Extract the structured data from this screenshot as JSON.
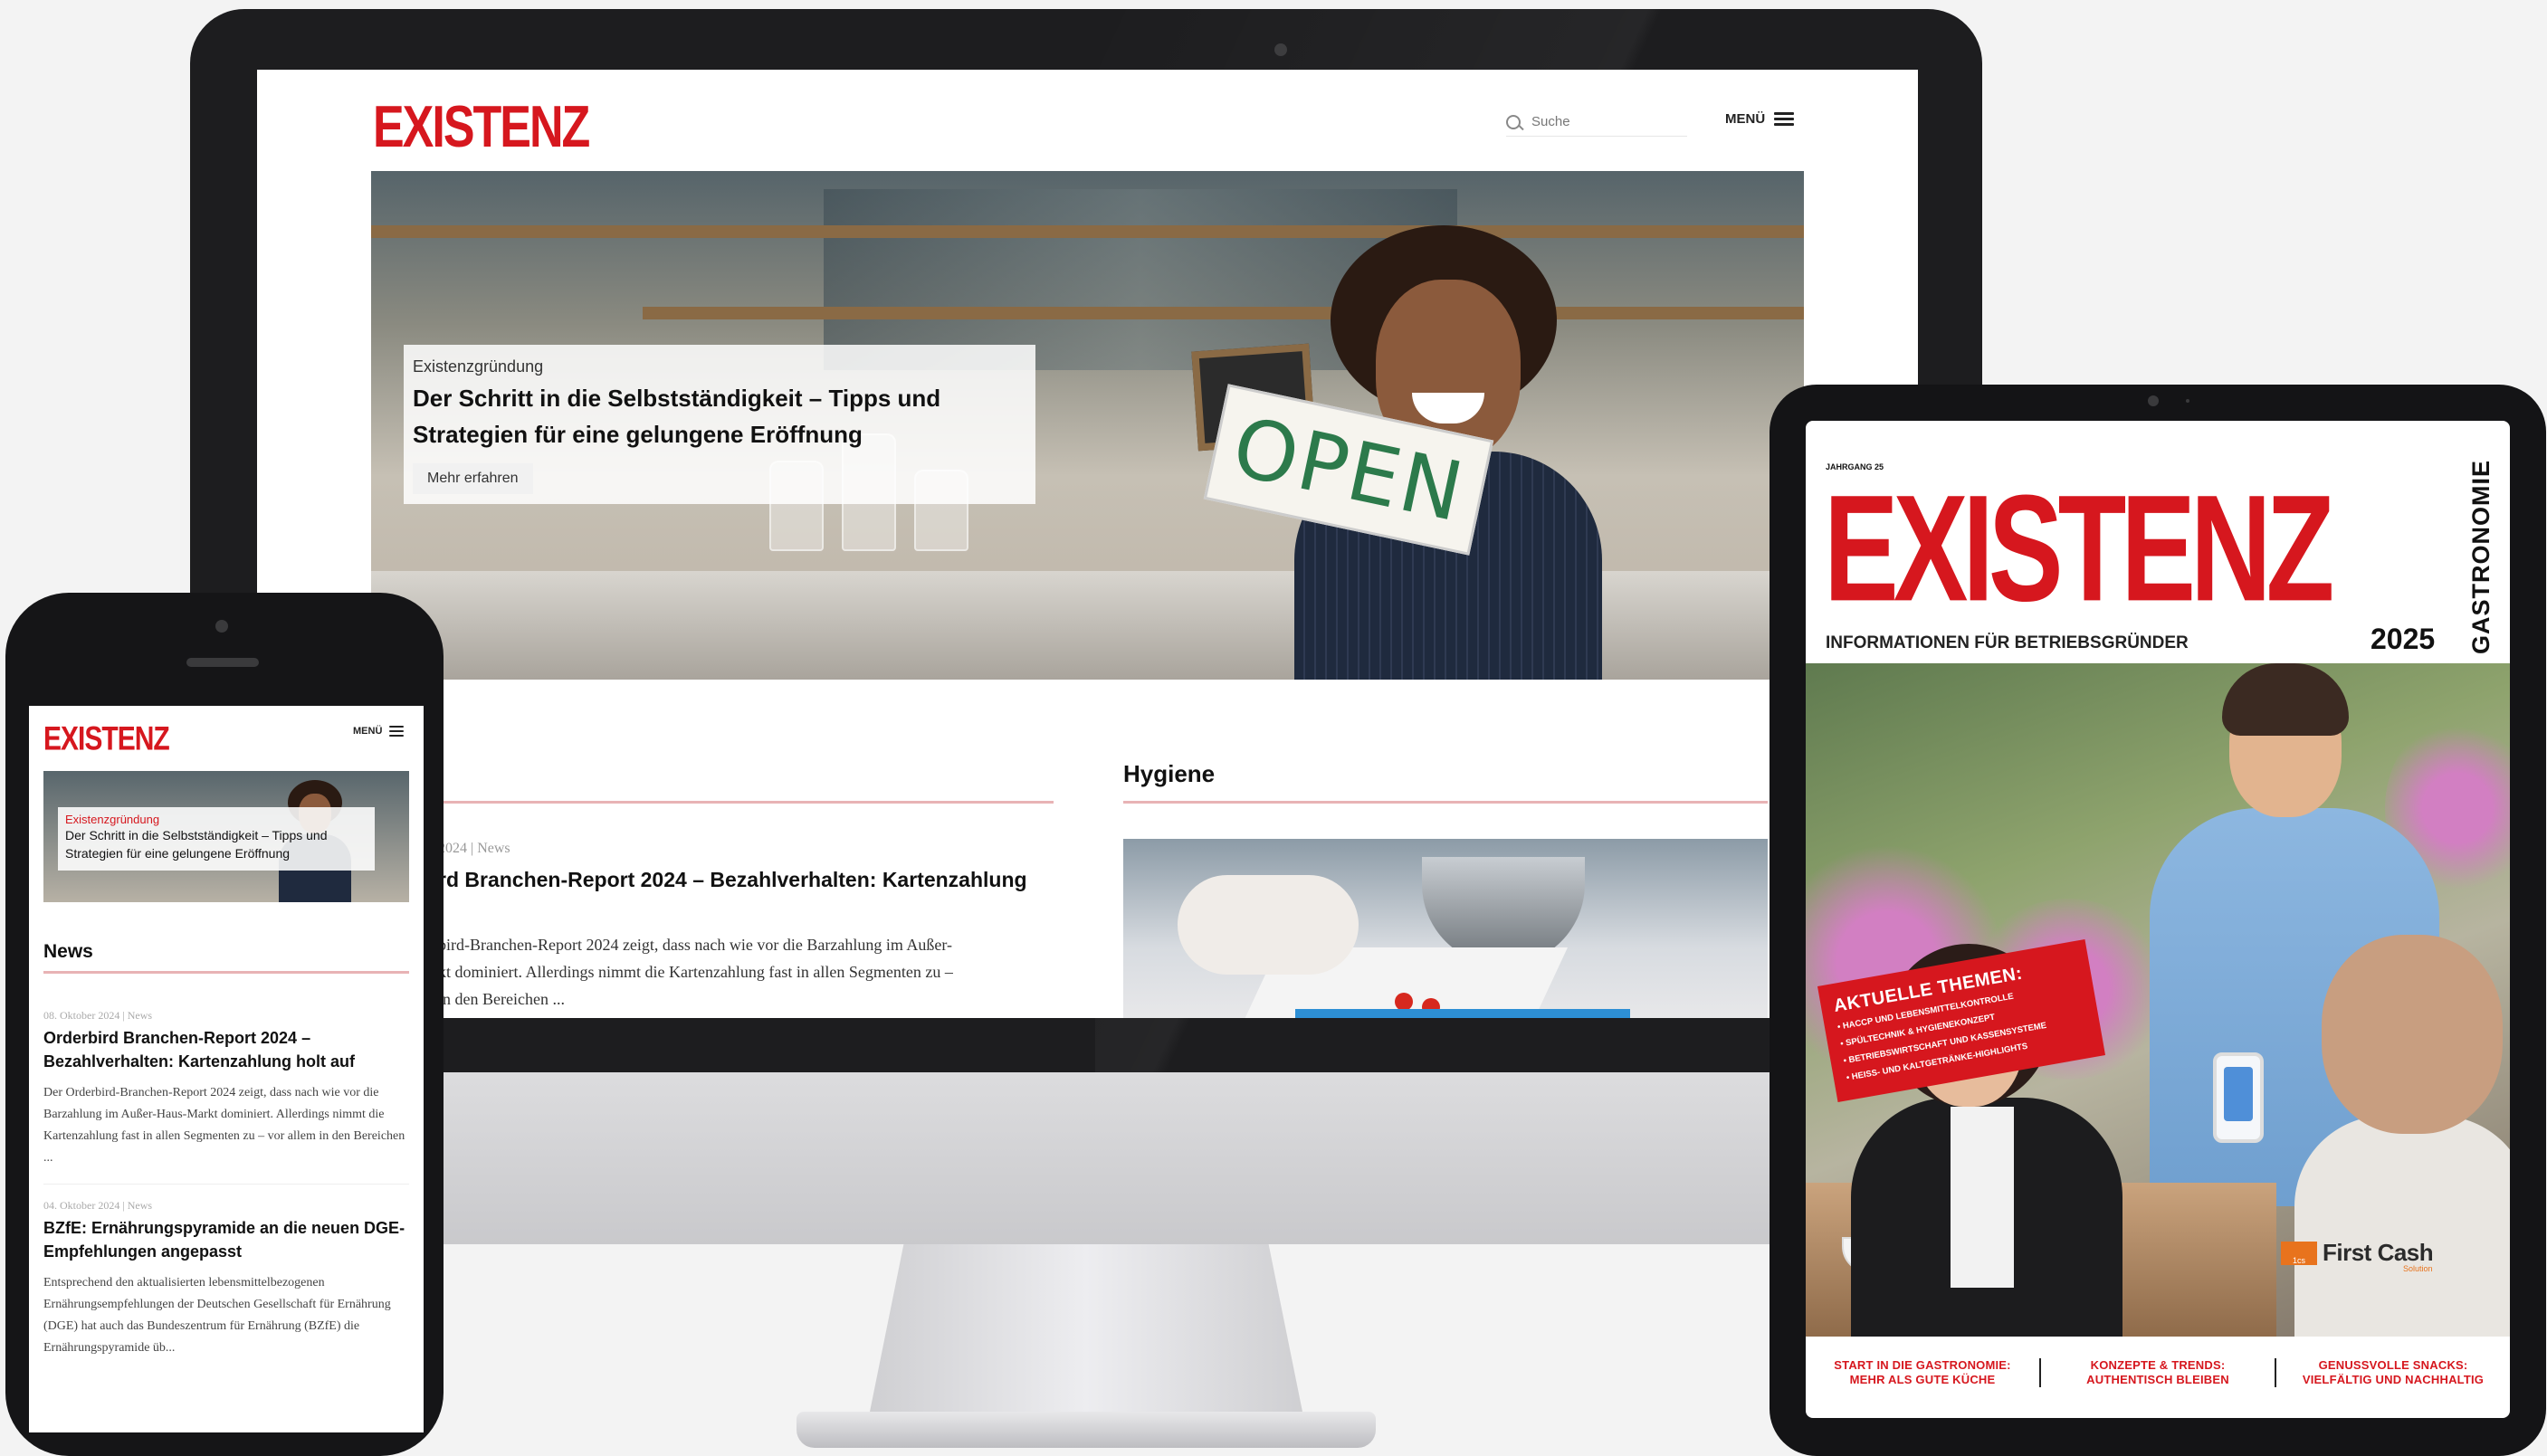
{
  "colors": {
    "brand_red": "#d6171e",
    "accent_line": "#e8b3b5",
    "orange": "#e8731d"
  },
  "desktop": {
    "logo": "EXISTENZ",
    "search_placeholder": "Suche",
    "menu_label": "MENÜ",
    "hero": {
      "kicker": "Existenzgründung",
      "title": "Der Schritt in die Selbstständigkeit – Tipps und Strategien für eine gelungene Eröffnung",
      "button": "Mehr erfahren",
      "sign_text": "OPEN"
    },
    "section_hygiene": "Hygiene",
    "news": {
      "date": "2024 | News",
      "title": "rd Branchen-Report 2024 – Bezahlverhalten: Kartenzahlung",
      "excerpt_lines": [
        "bird-Branchen-Report 2024 zeigt, dass nach wie vor die Barzahlung im Außer-",
        "kt dominiert. Allerdings nimmt die Kartenzahlung fast in allen Segmenten zu –",
        "in den Bereichen ..."
      ]
    }
  },
  "mobile": {
    "logo": "EXISTENZ",
    "menu_label": "MENÜ",
    "hero": {
      "kicker": "Existenzgründung",
      "title": "Der Schritt in die Selbstständigkeit – Tipps und Strategien für eine gelungene Eröffnung"
    },
    "section_news": "News",
    "articles": [
      {
        "date": "08. Oktober 2024 | News",
        "title": "Orderbird Branchen-Report 2024 – Bezahlverhalten: Kartenzahlung holt auf",
        "excerpt": "Der Orderbird-Branchen-Report 2024 zeigt, dass nach wie vor die Barzahlung im Außer-Haus-Markt dominiert. Allerdings nimmt die Kartenzahlung fast in allen Segmenten zu – vor allem in den Bereichen ..."
      },
      {
        "date": "04. Oktober 2024 | News",
        "title": "BZfE: Ernährungspyramide an die neuen DGE-Empfehlungen angepasst",
        "excerpt": "Entsprechend den aktualisierten lebensmittelbezogenen Ernährungsempfehlungen der Deutschen Gesellschaft für Ernährung (DGE) hat auch das Bundeszentrum für Ernährung (BZfE) die Ernährungspyramide üb..."
      }
    ]
  },
  "magazine": {
    "jahrgang": "JAHRGANG 25",
    "title": "EXISTENZ",
    "vertical": "GASTRONOMIE",
    "subtitle": "INFORMATIONEN FÜR BETRIEBSGRÜNDER",
    "year": "2025",
    "banner": {
      "heading": "AKTUELLE THEMEN:",
      "items": [
        "• HACCP UND LEBENSMITTELKONTROLLE",
        "• SPÜLTECHNIK & HYGIENEKONZEPT",
        "• BETRIEBSWIRTSCHAFT UND KASSENSYSTEME",
        "• HEISS- UND KALTGETRÄNKE-HIGHLIGHTS"
      ]
    },
    "advertiser": {
      "badge": "1cs",
      "name": "First Cash",
      "tagline": "Solution"
    },
    "footer": [
      {
        "line1": "START IN DIE GASTRONOMIE:",
        "line2": "MEHR ALS GUTE KÜCHE"
      },
      {
        "line1": "KONZEPTE & TRENDS:",
        "line2": "AUTHENTISCH BLEIBEN"
      },
      {
        "line1": "GENUSSVOLLE SNACKS:",
        "line2": "VIELFÄLTIG UND NACHHALTIG"
      }
    ]
  }
}
